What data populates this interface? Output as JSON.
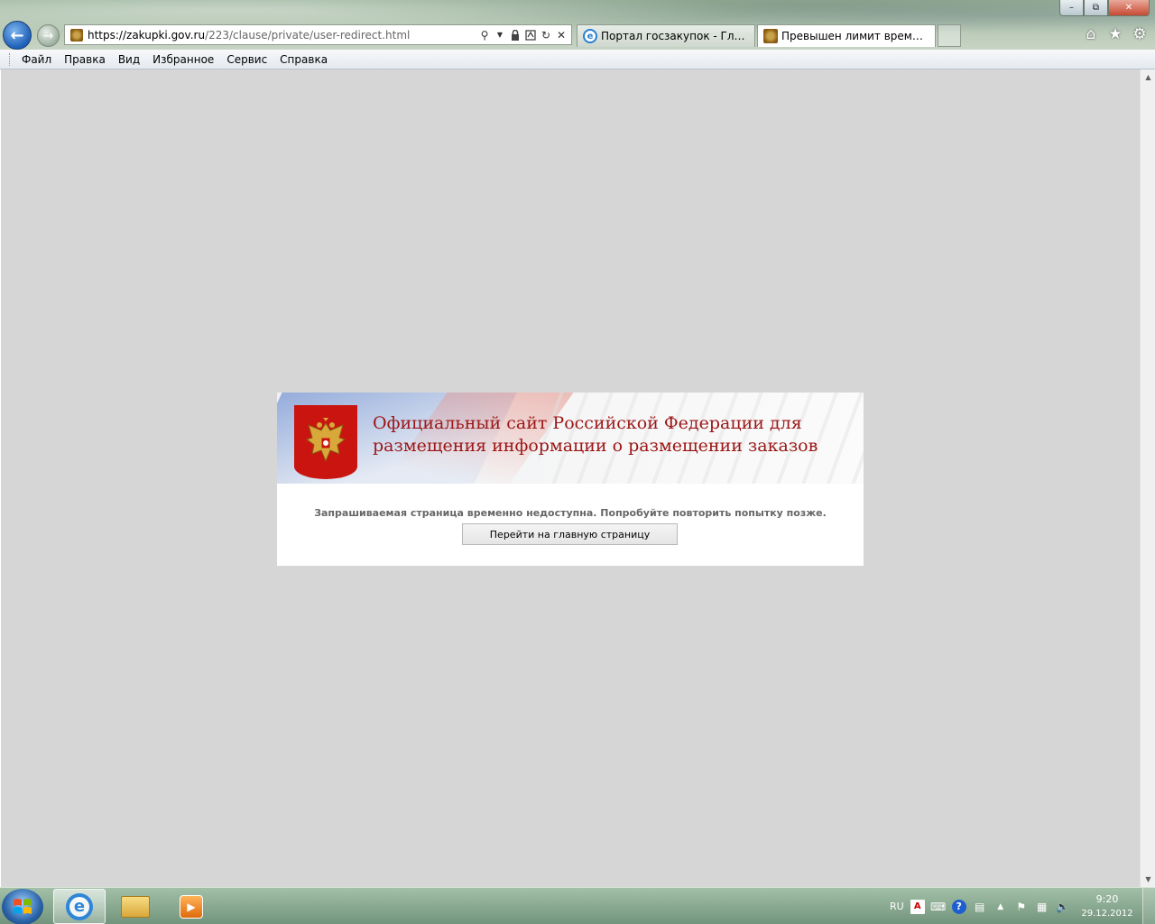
{
  "browser": {
    "window_controls": {
      "minimize": "–",
      "restore": "⧉",
      "close": "✕"
    },
    "nav": {
      "back_icon": "arrow-left-icon",
      "forward_icon": "arrow-right-icon"
    },
    "address_bar": {
      "url_host": "https://zakupki.gov.ru",
      "url_path": "/223/clause/private/user-redirect.html",
      "tool_icons": [
        "search-icon",
        "dropdown-icon",
        "lock-icon",
        "compat-icon",
        "refresh-icon",
        "stop-icon"
      ]
    },
    "tabs": [
      {
        "label": "Портал госзакупок - Главная",
        "icon": "ie-icon",
        "active": false
      },
      {
        "label": "Превышен лимит времен...",
        "icon": "eagle-favicon-icon",
        "active": true
      }
    ],
    "command_icons": [
      "home-icon",
      "favorites-star-icon",
      "tools-gear-icon"
    ],
    "menu": [
      "Файл",
      "Правка",
      "Вид",
      "Избранное",
      "Сервис",
      "Справка"
    ]
  },
  "page": {
    "site_title": "Официальный сайт Российской Федерации для размещения информации о размещении заказов",
    "message": "Запрашиваемая страница временно недоступна. Попробуйте повторить попытку позже.",
    "home_button_label": "Перейти на главную страницу",
    "background_color": "#d6d6d6",
    "title_color": "#9b1616",
    "emblem_color": "#c9140f"
  },
  "taskbar": {
    "pinned_apps": [
      "internet-explorer",
      "windows-explorer",
      "windows-media-player"
    ],
    "tray": {
      "language": "RU"
    },
    "clock": {
      "time": "9:20",
      "date": "29.12.2012"
    }
  }
}
